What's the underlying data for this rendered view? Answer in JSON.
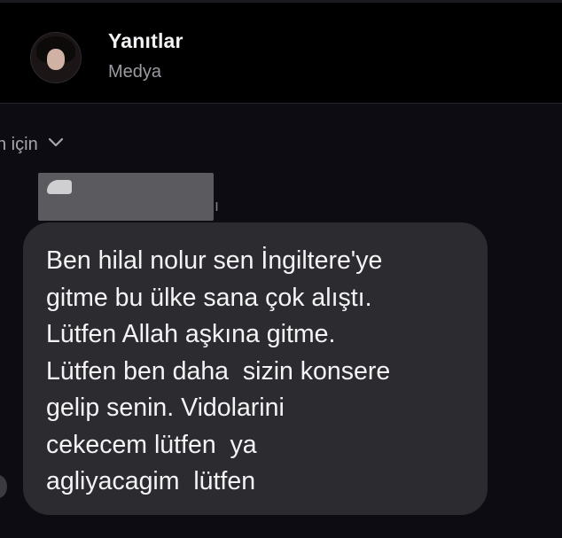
{
  "header": {
    "title": "Yanıtlar",
    "subtitle": "Medya"
  },
  "reply_context": {
    "label": "n için"
  },
  "sender": {
    "name_tail": "ı"
  },
  "message": {
    "text": "Ben hilal nolur sen İngiltere'ye\ngitme bu ülke sana çok alıştı.\nLütfen Allah aşkına gitme.\nLütfen ben daha  sizin konsere\ngelip senin. Vidolarini\ncekecem lütfen  ya\nagliyacagim  lütfen"
  },
  "icons": {
    "avatar": "profile-avatar",
    "chevron": "chevron-down-icon"
  },
  "colors": {
    "background": "#0c0c12",
    "header": "#000000",
    "bubble": "#2c2c30",
    "text": "#f4f4f6",
    "muted": "#9a9aa2"
  }
}
